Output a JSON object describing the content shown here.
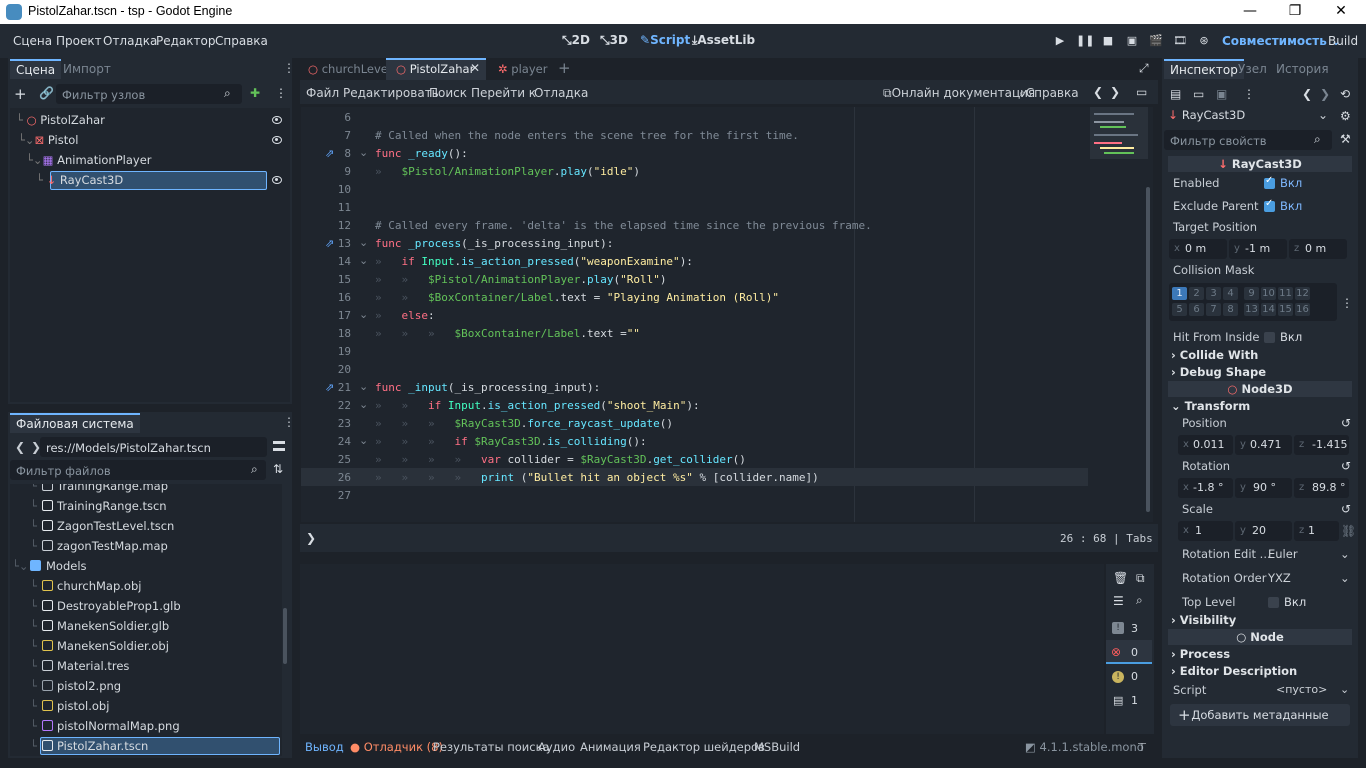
{
  "window": {
    "title": "PistolZahar.tscn - tsp - Godot Engine",
    "minimize": "—",
    "maximize": "❐",
    "close": "✕"
  },
  "menubar": {
    "items": [
      "Сцена",
      "Проект",
      "Отладка",
      "Редактор",
      "Справка"
    ],
    "workspaces": [
      "2D",
      "3D",
      "Script",
      "AssetLib"
    ],
    "active_workspace": "Script",
    "renderer": "Совместимость",
    "build": "Build"
  },
  "scene_dock": {
    "tabs": [
      "Сцена",
      "Импорт"
    ],
    "filter_placeholder": "Фильтр узлов",
    "nodes": [
      {
        "name": "PistolZahar",
        "depth": 0,
        "icon": "node3d-icon"
      },
      {
        "name": "Pistol",
        "depth": 1,
        "icon": "mesh-icon"
      },
      {
        "name": "AnimationPlayer",
        "depth": 2,
        "icon": "animation-player-icon"
      },
      {
        "name": "RayCast3D",
        "depth": 2,
        "icon": "raycast-icon",
        "selected": true
      }
    ]
  },
  "filesystem": {
    "tab": "Файловая система",
    "path": "res://Models/PistolZahar.tscn",
    "filter_placeholder": "Фильтр файлов",
    "files": [
      {
        "name": "TrainingRange.map",
        "depth": 1,
        "type": "file"
      },
      {
        "name": "TrainingRange.tscn",
        "depth": 1,
        "type": "scene"
      },
      {
        "name": "ZagonTestLevel.tscn",
        "depth": 1,
        "type": "scene"
      },
      {
        "name": "zagonTestMap.map",
        "depth": 1,
        "type": "file"
      },
      {
        "name": "Models",
        "depth": 0,
        "type": "folder"
      },
      {
        "name": "churchMap.obj",
        "depth": 1,
        "type": "mesh"
      },
      {
        "name": "DestroyableProp1.glb",
        "depth": 1,
        "type": "scene"
      },
      {
        "name": "ManekenSoldier.glb",
        "depth": 1,
        "type": "scene"
      },
      {
        "name": "ManekenSoldier.obj",
        "depth": 1,
        "type": "mesh"
      },
      {
        "name": "Material.tres",
        "depth": 1,
        "type": "material"
      },
      {
        "name": "pistol2.png",
        "depth": 1,
        "type": "image"
      },
      {
        "name": "pistol.obj",
        "depth": 1,
        "type": "mesh"
      },
      {
        "name": "pistolNormalMap.png",
        "depth": 1,
        "type": "image2"
      },
      {
        "name": "PistolZahar.tscn",
        "depth": 1,
        "type": "scene",
        "selected": true
      }
    ]
  },
  "editor_tabs": [
    {
      "name": "churchLevel",
      "active": false
    },
    {
      "name": "PistolZahar",
      "active": true
    },
    {
      "name": "player",
      "active": false
    }
  ],
  "script_menu": {
    "items": [
      "Файл",
      "Редактировать",
      "Поиск",
      "Перейти к",
      "Отладка"
    ],
    "online_docs": "Онлайн документация",
    "help": "Справка"
  },
  "code": {
    "lines": [
      {
        "n": "6",
        "html": ""
      },
      {
        "n": "7",
        "html": "<span class='cm'># Called when the node enters the scene tree for the first time.</span>"
      },
      {
        "n": "8",
        "html": "<span class='kw'>func</span> <span class='fn'>_ready</span>():",
        "fold": true,
        "conn": true
      },
      {
        "n": "9",
        "html": "<span class='tab-guide'>»</span>   <span class='np'>$Pistol/AnimationPlayer</span>.<span class='fn'>play</span>(<span class='str'>\"idle\"</span>)"
      },
      {
        "n": "10",
        "html": ""
      },
      {
        "n": "11",
        "html": ""
      },
      {
        "n": "12",
        "html": "<span class='cm'># Called every frame. 'delta' is the elapsed time since the previous frame.</span>"
      },
      {
        "n": "13",
        "html": "<span class='kw'>func</span> <span class='fn'>_process</span>(_is_processing_input):",
        "fold": true,
        "conn": true
      },
      {
        "n": "14",
        "html": "<span class='tab-guide'>»</span>   <span class='kw'>if</span> <span class='cls'>Input</span>.<span class='fn'>is_action_pressed</span>(<span class='str'>\"weaponExamine\"</span>):",
        "fold": true
      },
      {
        "n": "15",
        "html": "<span class='tab-guide'>»   »</span>   <span class='np'>$Pistol/AnimationPlayer</span>.<span class='fn'>play</span>(<span class='str'>\"Roll\"</span>)"
      },
      {
        "n": "16",
        "html": "<span class='tab-guide'>»   »</span>   <span class='np'>$BoxContainer/Label</span>.text = <span class='str'>\"Playing Animation (Roll)\"</span>"
      },
      {
        "n": "17",
        "html": "<span class='tab-guide'>»</span>   <span class='kw'>else</span>:",
        "fold": true
      },
      {
        "n": "18",
        "html": "<span class='tab-guide'>»   »   »</span>   <span class='np'>$BoxContainer/Label</span>.text =<span class='str'>\"\"</span>"
      },
      {
        "n": "19",
        "html": ""
      },
      {
        "n": "20",
        "html": ""
      },
      {
        "n": "21",
        "html": "<span class='kw'>func</span> <span class='fn'>_input</span>(_is_processing_input):",
        "fold": true,
        "conn": true
      },
      {
        "n": "22",
        "html": "<span class='tab-guide'>»   »</span>   <span class='kw'>if</span> <span class='cls'>Input</span>.<span class='fn'>is_action_pressed</span>(<span class='str'>\"shoot_Main\"</span>):",
        "fold": true
      },
      {
        "n": "23",
        "html": "<span class='tab-guide'>»   »   »</span>   <span class='np'>$RayCast3D</span>.<span class='fn'>force_raycast_update</span>()"
      },
      {
        "n": "24",
        "html": "<span class='tab-guide'>»   »   »</span>   <span class='kw'>if</span> <span class='np'>$RayCast3D</span>.<span class='fn'>is_colliding</span>():",
        "fold": true
      },
      {
        "n": "25",
        "html": "<span class='tab-guide'>»   »   »   »</span>   <span class='kw'>var</span> collider = <span class='np'>$RayCast3D</span>.<span class='fn'>get_collider</span>()"
      },
      {
        "n": "26",
        "html": "<span class='tab-guide'>»   »   »   »</span>   <span class='fn'>print</span> (<span class='str'>\"Bullet hit an object %s\"</span> % [collider.name])",
        "current": true
      },
      {
        "n": "27",
        "html": ""
      }
    ],
    "status_line": "26",
    "status_col": "68",
    "indent": "Tabs"
  },
  "output": {
    "counts": [
      "3",
      "0",
      "0",
      "1"
    ],
    "tabs": [
      "Вывод",
      "Отладчик (8)",
      "Результаты поиска",
      "Аудио",
      "Анимация",
      "Редактор шейдеров",
      "MSBuild"
    ],
    "version": "4.1.1.stable.mono"
  },
  "inspector": {
    "tabs": [
      "Инспектор",
      "Узел",
      "История"
    ],
    "object": "RayCast3D",
    "filter_placeholder": "Фильтр свойств",
    "class_header": "RayCast3D",
    "enabled_label": "Enabled",
    "enabled_value": "Вкл",
    "exclude_label": "Exclude Parent",
    "exclude_value": "Вкл",
    "target_label": "Target Position",
    "target": {
      "x": "0 m",
      "y": "-1 m",
      "z": "0 m"
    },
    "mask_label": "Collision Mask",
    "mask_row1": [
      "1",
      "2",
      "3",
      "4",
      "9",
      "10",
      "11",
      "12"
    ],
    "mask_row2": [
      "5",
      "6",
      "7",
      "8",
      "13",
      "14",
      "15",
      "16"
    ],
    "hit_inside_label": "Hit From Inside",
    "hit_inside_value": "Вкл",
    "collide_with": "Collide With",
    "debug_shape": "Debug Shape",
    "node3d_header": "Node3D",
    "transform": "Transform",
    "position_label": "Position",
    "position": {
      "x": "0.011",
      "y": "0.471",
      "z": "-1.415"
    },
    "rotation_label": "Rotation",
    "rotation": {
      "x": "-1.8 °",
      "y": "90 °",
      "z": "89.8 °"
    },
    "scale_label": "Scale",
    "scale": {
      "x": "1",
      "y": "20",
      "z": "1"
    },
    "rot_edit_label": "Rotation Edit ...",
    "rot_edit_value": "Euler",
    "rot_order_label": "Rotation Order",
    "rot_order_value": "YXZ",
    "top_level_label": "Top Level",
    "top_level_value": "Вкл",
    "visibility": "Visibility",
    "node_header": "Node",
    "process": "Process",
    "editor_desc": "Editor Description",
    "script_label": "Script",
    "script_value": "<пусто>",
    "add_meta": "Добавить метаданные"
  }
}
